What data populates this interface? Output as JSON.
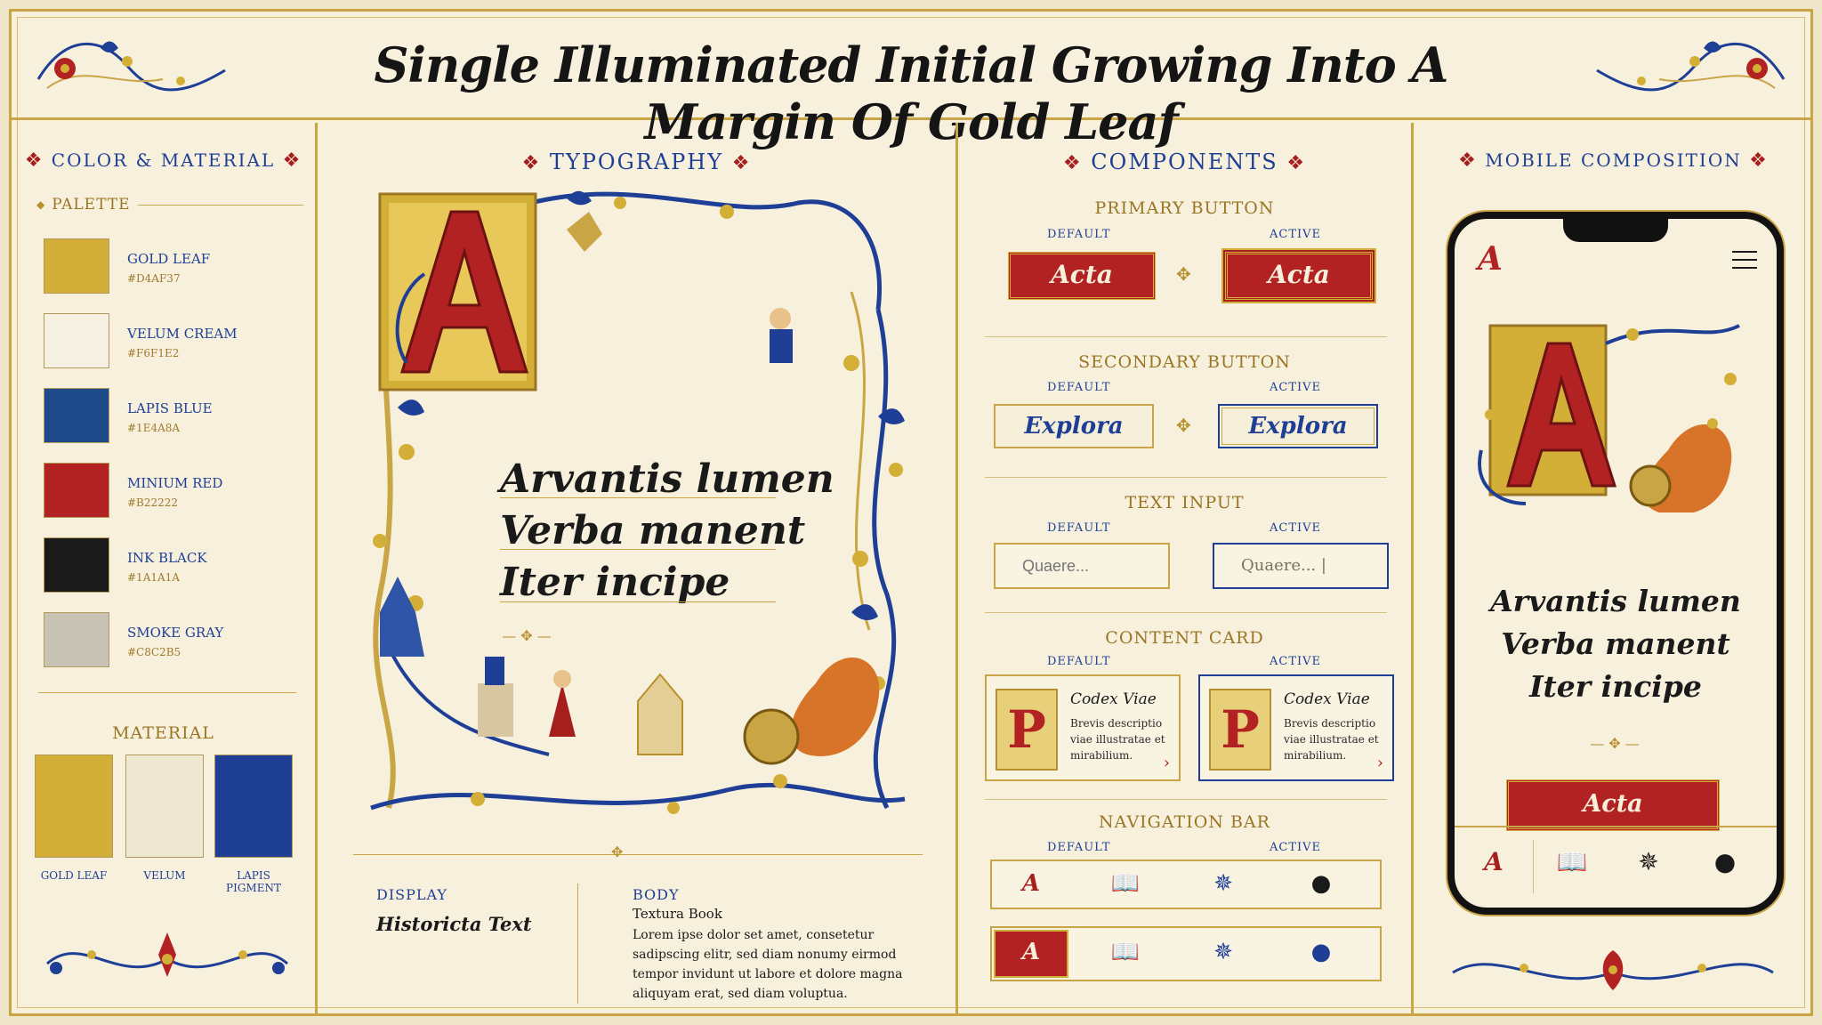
{
  "header": {
    "title": "Single Illuminated Initial Growing Into A Margin Of Gold Leaf"
  },
  "color_material": {
    "title": "COLOR & MATERIAL",
    "palette_title": "PALETTE",
    "swatches": [
      {
        "name": "GOLD LEAF",
        "hex": "#D4AF37",
        "color": "#D4AF37"
      },
      {
        "name": "VELUM CREAM",
        "hex": "#F6F1E2",
        "color": "#F6F1E2"
      },
      {
        "name": "LAPIS BLUE",
        "hex": "#1E4A8A",
        "color": "#1E4A8A"
      },
      {
        "name": "MINIUM RED",
        "hex": "#B22222",
        "color": "#B22222"
      },
      {
        "name": "INK BLACK",
        "hex": "#1A1A1A",
        "color": "#1A1A1A"
      },
      {
        "name": "SMOKE GRAY",
        "hex": "#C8C2B5",
        "color": "#C8C2B5"
      }
    ],
    "material_title": "MATERIAL",
    "materials": [
      {
        "name": "GOLD LEAF",
        "color": "#D4AF37"
      },
      {
        "name": "VELUM",
        "color": "#EFE8D2"
      },
      {
        "name": "LAPIS PIGMENT",
        "color": "#1F3F95"
      }
    ]
  },
  "typography": {
    "title": "TYPOGRAPHY",
    "initial": "A",
    "phrases": [
      "Arvantis lumen",
      "Verba manent",
      "Iter incipe"
    ],
    "display_label": "DISPLAY",
    "display_font": "Historicta Text",
    "body_label": "BODY",
    "body_font": "Textura Book",
    "body_text": "Lorem ipse dolor set amet, consetetur sadipscing elitr, sed diam nonumy eirmod tempor invidunt ut labore et dolore magna aliquyam erat, sed diam voluptua."
  },
  "components": {
    "title": "COMPONENTS",
    "default_label": "DEFAULT",
    "active_label": "ACTIVE",
    "primary_button": {
      "title": "PRIMARY BUTTON",
      "label": "Acta"
    },
    "secondary_button": {
      "title": "SECONDARY BUTTON",
      "label": "Explora"
    },
    "text_input": {
      "title": "TEXT INPUT",
      "placeholder": "Quaere...",
      "active_value": "Quaere... |"
    },
    "content_card": {
      "title": "CONTENT CARD",
      "card_title": "Codex Viae",
      "card_desc": "Brevis descriptio viae illustratae et mirabilium.",
      "initial": "P"
    },
    "navigation_bar": {
      "title": "NAVIGATION BAR",
      "logo": "A"
    }
  },
  "mobile": {
    "title": "MOBILE COMPOSITION",
    "logo": "A",
    "initial": "A",
    "phrases": [
      "Arvantis lumen",
      "Verba manent",
      "Iter incipe"
    ],
    "button_label": "Acta",
    "nav_logo": "A"
  },
  "icons": [
    "book-icon",
    "compass-icon",
    "person-icon",
    "menu-icon",
    "chevron-right-icon",
    "fleuron-icon"
  ]
}
